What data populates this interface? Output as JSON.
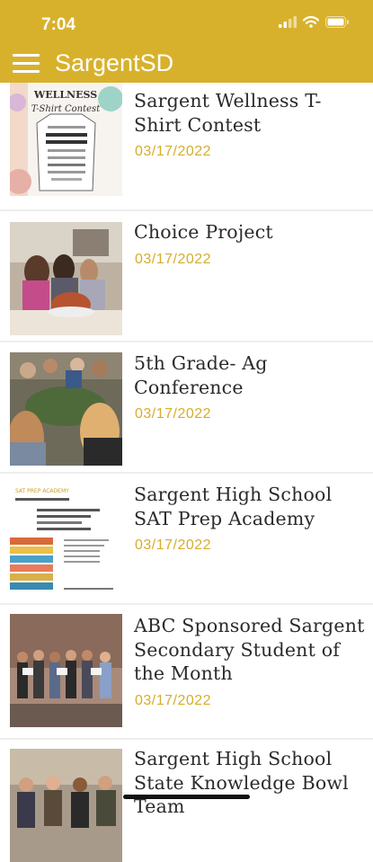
{
  "status_bar": {
    "time": "7:04"
  },
  "app_bar": {
    "title": "SargentSD",
    "menu_icon": "hamburger-menu-icon"
  },
  "news": [
    {
      "title": "Sargent Wellness T-Shirt Contest",
      "date": "03/17/2022"
    },
    {
      "title": "Choice Project",
      "date": "03/17/2022"
    },
    {
      "title": "5th Grade- Ag Conference",
      "date": "03/17/2022"
    },
    {
      "title": "Sargent High School SAT Prep Academy",
      "date": "03/17/2022"
    },
    {
      "title": "ABC Sponsored Sargent Secondary Student of the Month",
      "date": "03/17/2022"
    },
    {
      "title": "Sargent High School State Knowledge Bowl Team",
      "date": ""
    }
  ],
  "thumbnails": {
    "tshirt_heading": "WELLNESS",
    "tshirt_subheading": "T-Shirt Contest",
    "sat_heading": "SAT PREP ACADEMY"
  },
  "colors": {
    "brand": "#d8b12c",
    "date": "#d6ad2a"
  }
}
